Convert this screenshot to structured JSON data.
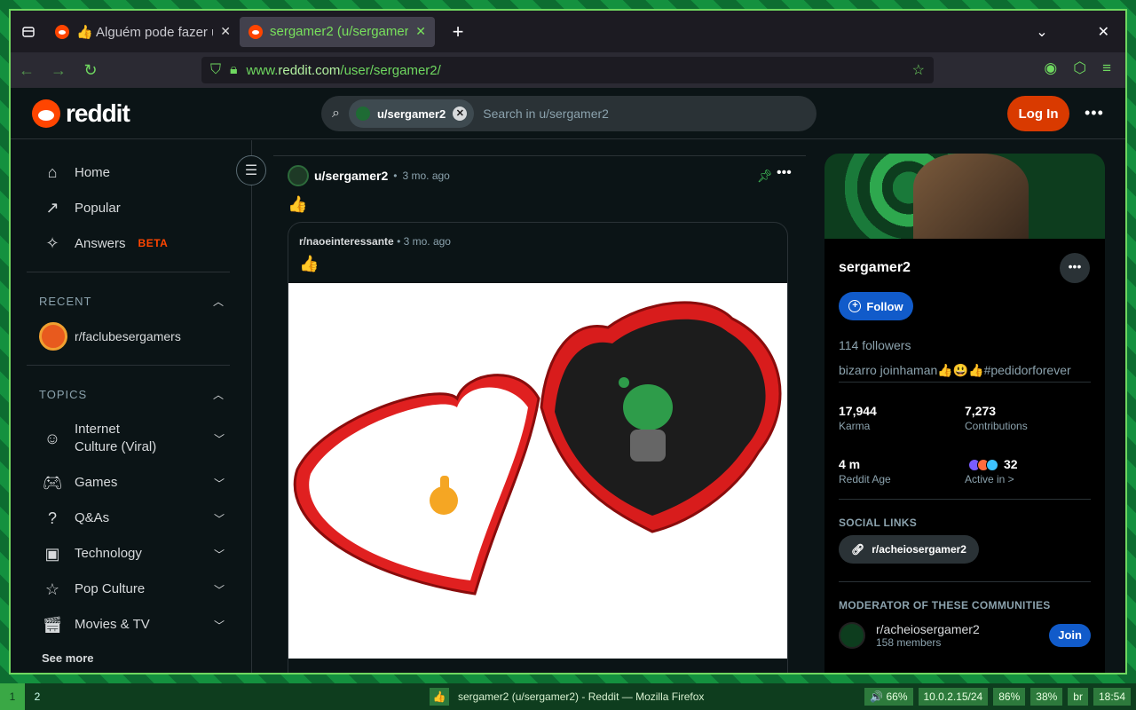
{
  "browser": {
    "tabs": [
      {
        "title": "👍 Alguém pode fazer um",
        "active": false
      },
      {
        "title": "sergamer2 (u/sergamer2) - Reddit",
        "active": true
      }
    ],
    "url_prefix": "www.",
    "url_domain": "reddit.com",
    "url_path": "/user/sergamer2/"
  },
  "header": {
    "logo_text": "reddit",
    "search_chip": "u/sergamer2",
    "search_placeholder": "Search in u/sergamer2",
    "login_label": "Log In"
  },
  "sidebar": {
    "nav": [
      {
        "label": "Home",
        "icon": "home-icon"
      },
      {
        "label": "Popular",
        "icon": "popular-icon"
      },
      {
        "label": "Answers",
        "icon": "answers-icon",
        "badge": "BETA"
      }
    ],
    "recent_title": "RECENT",
    "recent_items": [
      {
        "label": "r/faclubesergamers"
      }
    ],
    "topics_title": "TOPICS",
    "topics": [
      {
        "label": "Internet Culture (Viral)",
        "icon": "internet-culture-icon"
      },
      {
        "label": "Games",
        "icon": "gamepad-icon"
      },
      {
        "label": "Q&As",
        "icon": "qa-icon"
      },
      {
        "label": "Technology",
        "icon": "chip-icon"
      },
      {
        "label": "Pop Culture",
        "icon": "star-icon"
      },
      {
        "label": "Movies & TV",
        "icon": "clapperboard-icon"
      }
    ],
    "see_more": "See more"
  },
  "post": {
    "author": "u/sergamer2",
    "time": "3 mo. ago",
    "body": "👍",
    "crosspost": {
      "subreddit": "r/naoeinteressante",
      "time": "3 mo. ago",
      "body": "👍"
    }
  },
  "profile": {
    "name": "sergamer2",
    "follow_label": "Follow",
    "followers": "114 followers",
    "bio": "bizarro joinhaman👍😃👍#pedidorforever",
    "stats": [
      {
        "value": "17,944",
        "label": "Karma"
      },
      {
        "value": "7,273",
        "label": "Contributions"
      },
      {
        "value": "4 m",
        "label": "Reddit Age"
      },
      {
        "value": "32",
        "label": "Active in >"
      }
    ],
    "social_links_title": "SOCIAL LINKS",
    "social_link": "r/acheiosergamer2",
    "moderator_title": "MODERATOR OF THESE COMMUNITIES",
    "mod_community": {
      "name": "r/acheiosergamer2",
      "members": "158 members",
      "join_label": "Join"
    }
  },
  "taskbar": {
    "workspaces": [
      "1",
      "2"
    ],
    "window_title": "sergamer2 (u/sergamer2) - Reddit — Mozilla Firefox",
    "tray": [
      "🔊 66%",
      "10.0.2.15/24",
      "86%",
      "38%",
      "br",
      "18:54"
    ]
  },
  "colors": {
    "accent": "#ff4500",
    "follow": "#115bca",
    "theme_green": "#6fd860"
  }
}
